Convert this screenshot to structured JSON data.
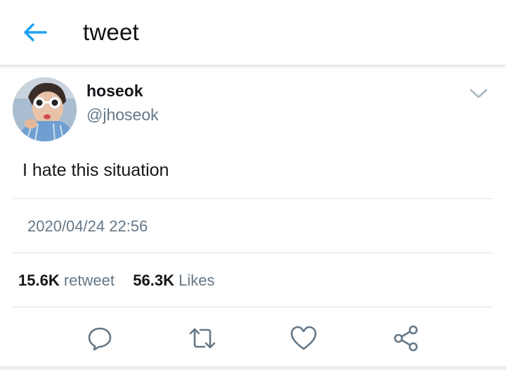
{
  "header": {
    "title": "tweet",
    "back_icon": "arrow-left-icon",
    "accent": "#1da1f2"
  },
  "tweet": {
    "author_name": "hoseok",
    "author_handle": "@jhoseok",
    "text": "I hate this situation",
    "timestamp": "2020/04/24 22:56",
    "retweet_count": "15.6K",
    "retweet_label": "retweet",
    "likes_count": "56.3K",
    "likes_label": "Likes",
    "menu_icon": "chevron-down-icon"
  },
  "actions": [
    {
      "icon": "reply-icon"
    },
    {
      "icon": "retweet-icon"
    },
    {
      "icon": "like-icon"
    },
    {
      "icon": "share-icon"
    }
  ],
  "colors": {
    "text": "#14171a",
    "secondary": "#657786",
    "divider": "#e1e4e6",
    "icon": "#657786"
  }
}
